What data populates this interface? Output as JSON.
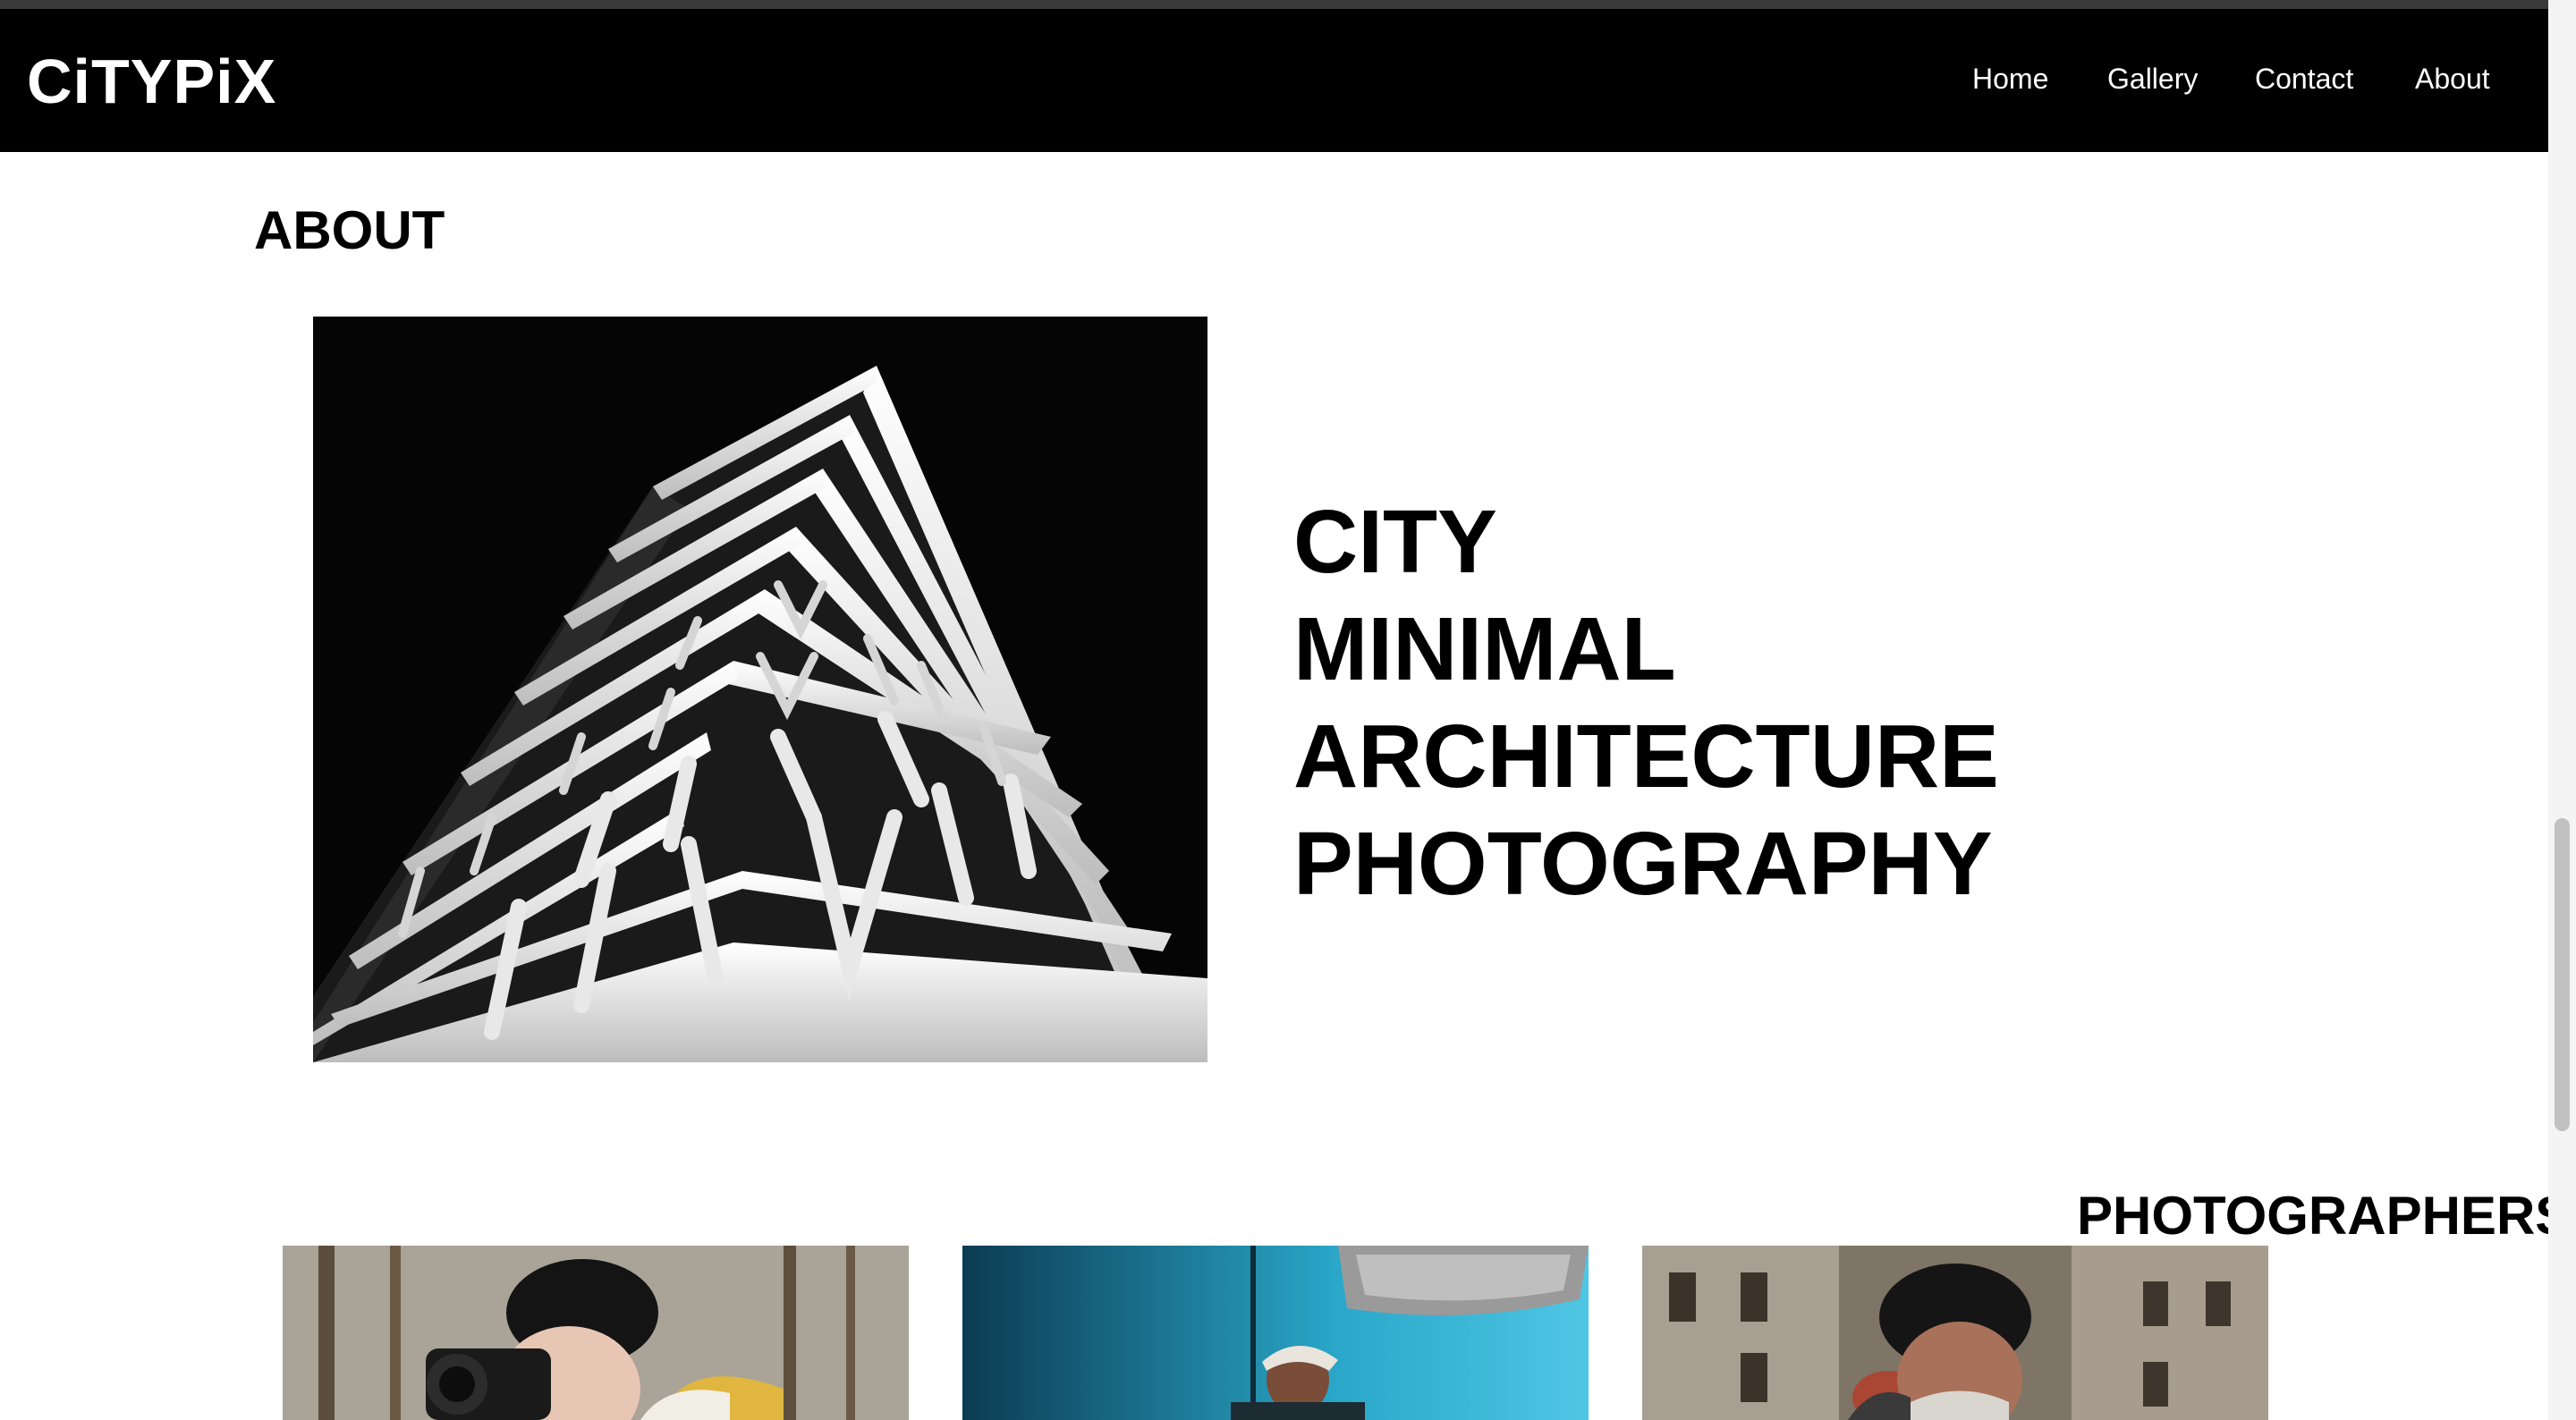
{
  "site": {
    "logo": "CiTYPiX"
  },
  "nav": {
    "items": [
      {
        "label": "Home"
      },
      {
        "label": "Gallery"
      },
      {
        "label": "Contact"
      },
      {
        "label": "About"
      }
    ]
  },
  "about": {
    "title": "ABOUT",
    "image_icon": "building-photo",
    "headline": [
      "CITY",
      "MINIMAL",
      "ARCHITECTURE",
      "PHOTOGRAPHY"
    ]
  },
  "photographers": {
    "title": "PHOTOGRAPHERS",
    "cards": [
      {
        "icon": "photographer-photo"
      },
      {
        "icon": "photographer-photo"
      },
      {
        "icon": "photographer-photo"
      }
    ]
  },
  "colors": {
    "nav_bg": "#000000",
    "text": "#000000",
    "nav_text": "#ffffff"
  }
}
